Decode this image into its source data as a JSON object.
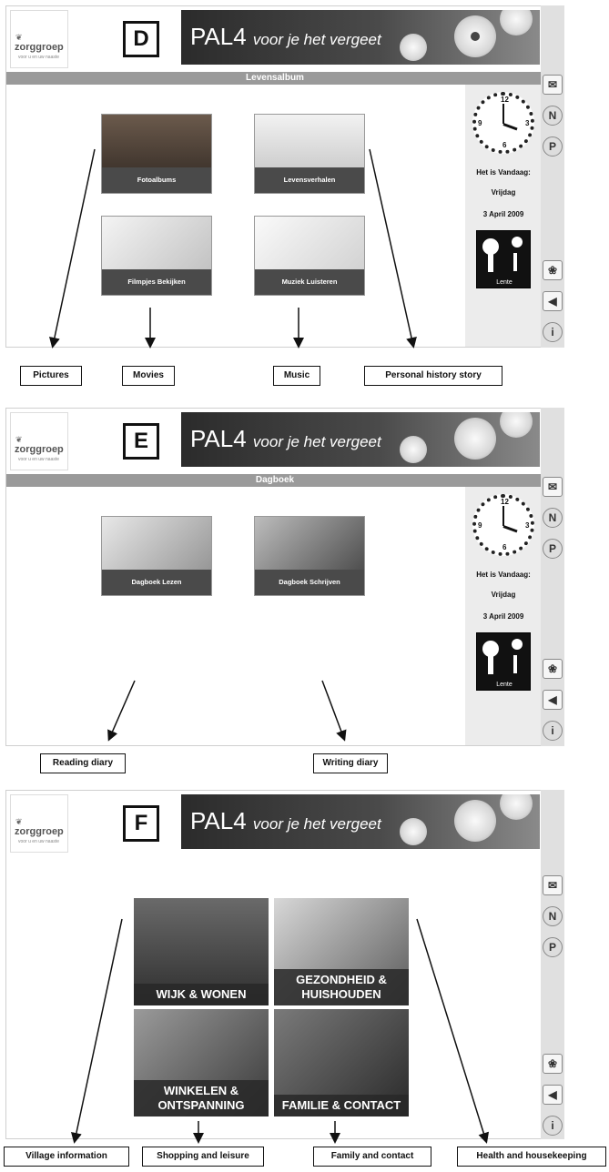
{
  "brand": {
    "logo_text": "zorggroep",
    "logo_sub": "voor u en uw naaste",
    "app_title": "PAL4",
    "app_tagline": "voor je het vergeet"
  },
  "sidebar": {
    "today_label": "Het is Vandaag:",
    "day": "Vrijdag",
    "date": "3 April 2009",
    "season": "Lente"
  },
  "rail_icons": [
    "mail-icon",
    "n-icon",
    "p-icon",
    "paw-icon",
    "back-icon",
    "info-icon"
  ],
  "panel_d": {
    "letter": "D",
    "title": "Levensalbum",
    "tiles": [
      "Fotoalbums",
      "Levensverhalen",
      "Filmpjes Bekijken",
      "Muziek Luisteren"
    ],
    "labels": [
      "Pictures",
      "Movies",
      "Music",
      "Personal history story"
    ]
  },
  "panel_e": {
    "letter": "E",
    "title": "Dagboek",
    "tiles": [
      "Dagboek Lezen",
      "Dagboek Schrijven"
    ],
    "labels": [
      "Reading diary",
      "Writing diary"
    ]
  },
  "panel_f": {
    "letter": "F",
    "tiles": [
      "WIJK & WONEN",
      "GEZONDHEID & HUISHOUDEN",
      "WINKELEN & ONTSPANNING",
      "FAMILIE & CONTACT"
    ],
    "labels": [
      "Village information",
      "Shopping and leisure",
      "Family and contact",
      "Health and housekeeping"
    ]
  }
}
